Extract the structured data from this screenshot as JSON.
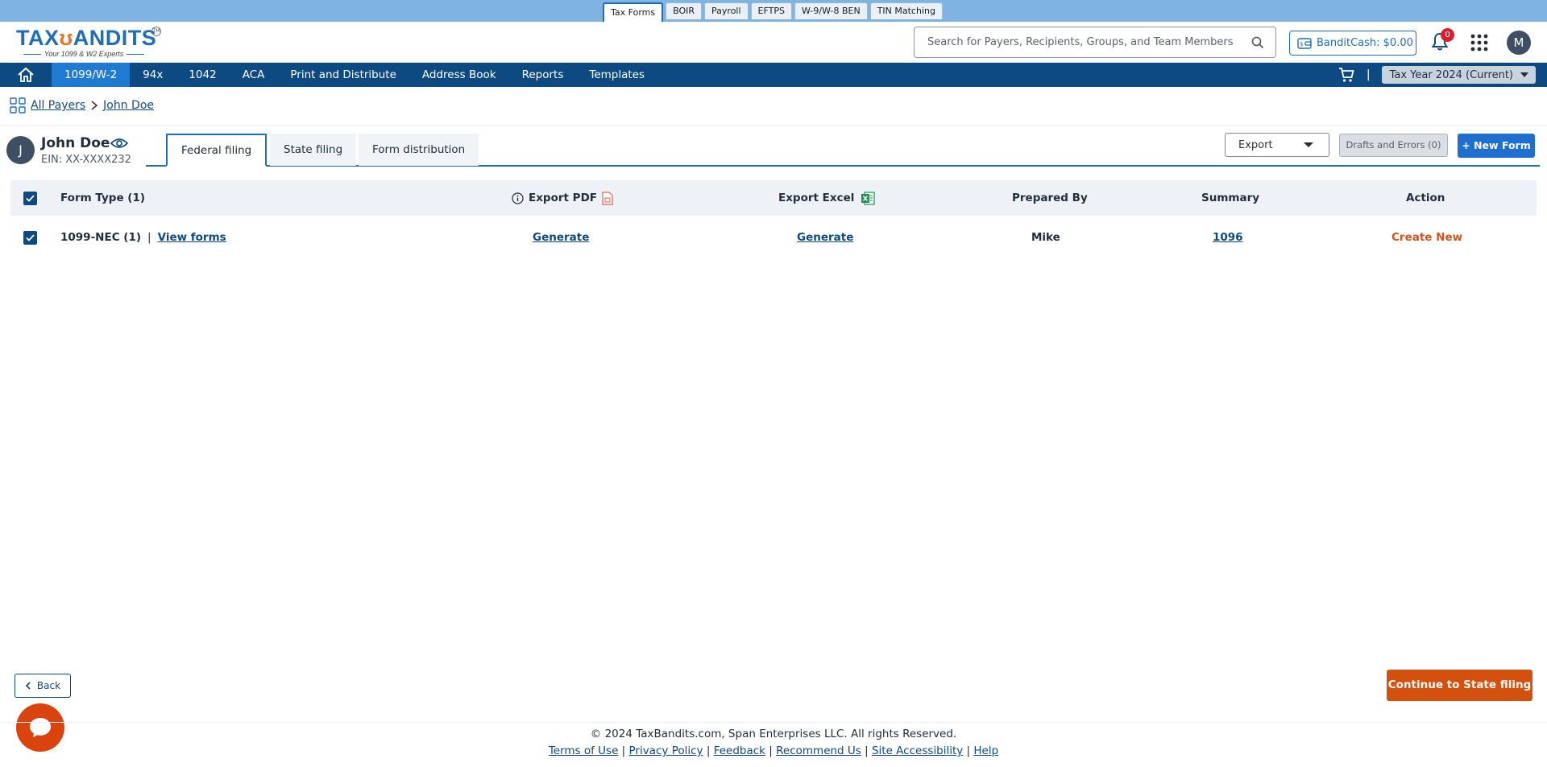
{
  "product_tabs": [
    "Tax Forms",
    "BOIR",
    "Payroll",
    "EFTPS",
    "W-9/W-8 BEN",
    "TIN Matching"
  ],
  "header": {
    "logo_text_left": "TAX",
    "logo_text_right": "ANDITS",
    "logo_tagline": "Your 1099 & W2 Experts",
    "search_placeholder": "Search for Payers, Recipients, Groups, and Team Members",
    "bandit_cash": "BanditCash: $0.00",
    "notification_count": "0",
    "user_initial": "M"
  },
  "nav": {
    "items": [
      "1099/W-2",
      "94x",
      "1042",
      "ACA",
      "Print and Distribute",
      "Address Book",
      "Reports",
      "Templates"
    ],
    "active": "1099/W-2",
    "separator": "|",
    "tax_year": "Tax Year 2024 (Current)"
  },
  "breadcrumb": {
    "all_payers": "All Payers",
    "current": "John Doe"
  },
  "payer": {
    "initial": "J",
    "name": "John Doe",
    "ein": "EIN: XX-XXXX232"
  },
  "tabs": [
    "Federal filing",
    "State filing",
    "Form distribution"
  ],
  "actions": {
    "export": "Export",
    "drafts": "Drafts and Errors (0)",
    "new_form": "New Form"
  },
  "table": {
    "headers": {
      "form_type": "Form Type  (1)",
      "export_pdf": "Export PDF",
      "export_excel": "Export Excel",
      "prepared_by": "Prepared By",
      "summary": "Summary",
      "action": "Action"
    },
    "rows": [
      {
        "form_type": "1099-NEC (1)",
        "separator": "|",
        "view_forms": "View forms",
        "export_pdf": "Generate",
        "export_excel": "Generate",
        "prepared_by": "Mike",
        "summary": "1096",
        "action": "Create New"
      }
    ]
  },
  "bottom": {
    "back": "Back",
    "continue": "Continue to State filing"
  },
  "footer": {
    "copyright": "© 2024 TaxBandits.com, Span Enterprises LLC. All rights Reserved.",
    "links": [
      "Terms of Use",
      "Privacy Policy",
      "Feedback",
      "Recommend Us",
      "Site Accessibility",
      "Help"
    ],
    "separator": " | "
  },
  "colors": {
    "primary": "#0e4a82",
    "accent_blue": "#1f6fd1",
    "accent_orange": "#d4500f"
  }
}
